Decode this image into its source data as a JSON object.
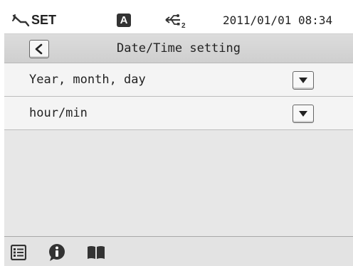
{
  "status": {
    "mode_label": "SET",
    "badge_letter": "A",
    "usb_sub": "2",
    "datetime": "2011/01/01 08:34",
    "icons": [
      "wrench-icon",
      "auto-mode-icon",
      "usb-icon"
    ]
  },
  "header": {
    "title": "Date/Time setting",
    "back_icon": "chevron-left-icon"
  },
  "settings": [
    {
      "label": "Year, month, day",
      "control_icon": "dropdown-arrow-icon"
    },
    {
      "label": "hour/min",
      "control_icon": "dropdown-arrow-icon"
    }
  ],
  "toolbar": {
    "icons": [
      "list-icon",
      "info-icon",
      "book-icon"
    ]
  },
  "colors": {
    "background": "#e7e7e7",
    "row": "#f4f4f4",
    "titlebar": "#d4d4d4",
    "icon": "#333333"
  }
}
